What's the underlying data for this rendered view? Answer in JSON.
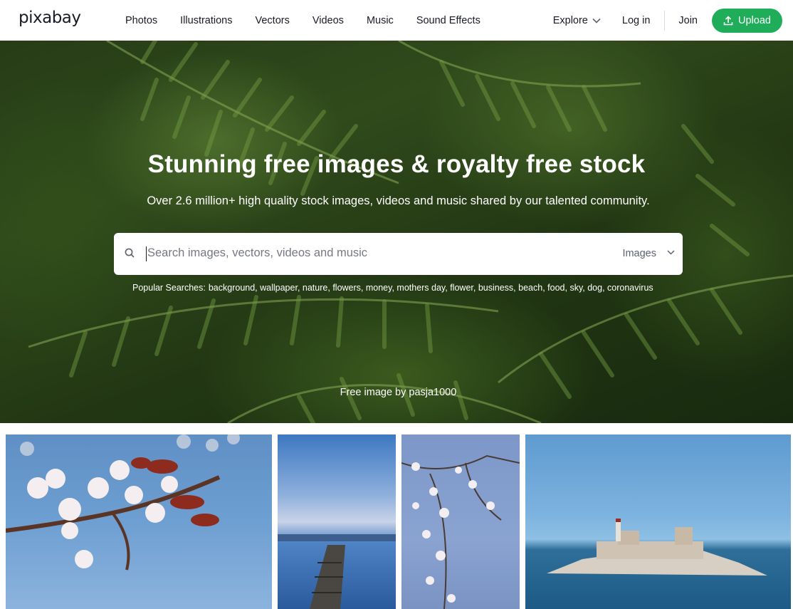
{
  "header": {
    "logo": "pixabay",
    "nav": [
      "Photos",
      "Illustrations",
      "Vectors",
      "Videos",
      "Music",
      "Sound Effects"
    ],
    "explore": "Explore",
    "login": "Log in",
    "join": "Join",
    "upload": "Upload"
  },
  "hero": {
    "title": "Stunning free images & royalty free stock",
    "subtitle": "Over 2.6 million+ high quality stock images, videos and music shared by our talented community.",
    "search_placeholder": "Search images, vectors, videos and music",
    "search_type": "Images",
    "popular_label": "Popular Searches:",
    "popular_terms": [
      "background",
      "wallpaper",
      "nature",
      "flowers",
      "money",
      "mothers day",
      "flower",
      "business",
      "beach",
      "food",
      "sky",
      "dog",
      "coronavirus"
    ],
    "credit": "Free image by pasja1000"
  },
  "colors": {
    "accent": "#1fad5a",
    "text": "#191b26"
  },
  "icons": {
    "search": "search-icon",
    "chevron": "chevron-down-icon",
    "upload": "upload-icon"
  }
}
